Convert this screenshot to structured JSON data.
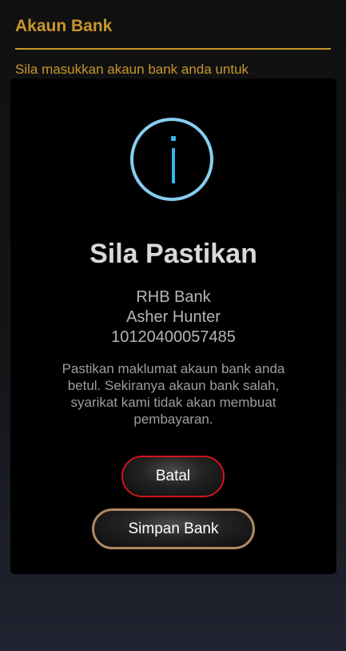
{
  "page": {
    "title": "Akaun Bank",
    "instruction": "Sila masukkan akaun bank anda untuk"
  },
  "dialog": {
    "icon": "info-icon",
    "title": "Sila Pastikan",
    "bank_name": "RHB Bank",
    "account_holder": "Asher Hunter",
    "account_number": "10120400057485",
    "message": "Pastikan maklumat akaun bank anda betul. Sekiranya akaun bank salah, syarikat kami tidak akan membuat pembayaran.",
    "cancel_label": "Batal",
    "save_label": "Simpan Bank"
  },
  "colors": {
    "accent_gold": "#c8962a",
    "info_blue": "#37b6ee",
    "cancel_border": "#d0141e",
    "save_border": "#b08a64"
  }
}
